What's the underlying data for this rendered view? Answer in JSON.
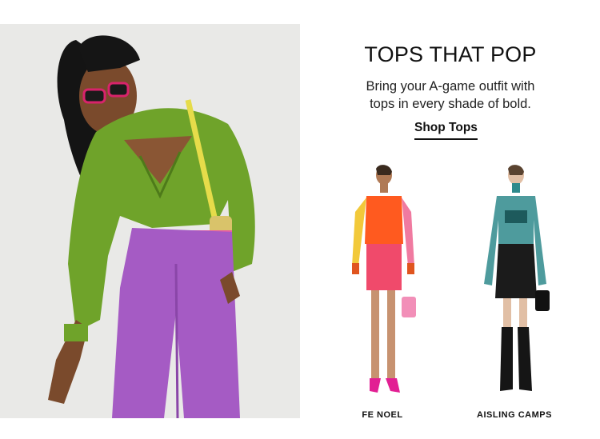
{
  "promo": {
    "title": "TOPS THAT POP",
    "subtitle_line1": "Bring your A-game outfit with",
    "subtitle_line2": "tops in every shade of bold.",
    "cta_label": "Shop Tops"
  },
  "products": [
    {
      "brand": "FE NOEL"
    },
    {
      "brand": "AISLING CAMPS"
    }
  ],
  "colors": {
    "hero_background": "#e9e9e7",
    "green_top": "#6fa32a",
    "purple_pants": "#a55bc4",
    "orange_shirt": "#ff5a1f",
    "pink_skirt": "#f04a6b",
    "teal_top": "#2f8a8c",
    "black_skirt": "#1b1b1b"
  }
}
